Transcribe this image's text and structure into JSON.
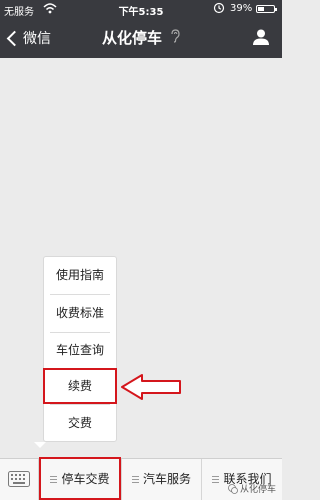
{
  "status": {
    "carrier": "无服务",
    "time": "下午5:35",
    "battery": "39%",
    "battery_fraction": 0.39
  },
  "nav": {
    "back_label": "微信",
    "title": "从化停车"
  },
  "popup": {
    "items": [
      "使用指南",
      "收费标准",
      "车位查询",
      "续费",
      "交费"
    ]
  },
  "menu": {
    "buttons": [
      "停车交费",
      "汽车服务",
      "联系我们"
    ]
  },
  "watermark": {
    "text": "从化停车"
  },
  "colors": {
    "header": "#393a3f",
    "background": "#ebebeb",
    "annotation": "#d4161c"
  },
  "icons": {
    "back": "chevron-left-icon",
    "ear": "ear-icon",
    "profile": "profile-icon",
    "keyboard": "keyboard-icon",
    "annotation": "arrow-left-icon"
  }
}
